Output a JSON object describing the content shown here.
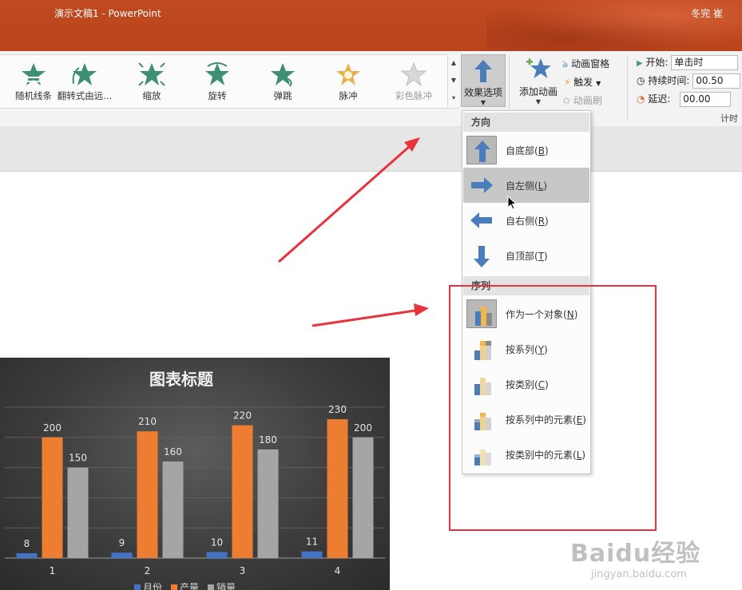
{
  "window": {
    "title": "演示文稿1  -  PowerPoint",
    "user": "冬完 崔"
  },
  "ribbon": {
    "gallery": [
      {
        "label": "随机线条",
        "icon": "random-bars-icon",
        "enabled": true
      },
      {
        "label": "翻转式由远...",
        "icon": "flip-icon",
        "enabled": true
      },
      {
        "label": "缩放",
        "icon": "zoom-icon",
        "enabled": true
      },
      {
        "label": "旋转",
        "icon": "spin-icon",
        "enabled": true
      },
      {
        "label": "弹跳",
        "icon": "bounce-icon",
        "enabled": true
      },
      {
        "label": "脉冲",
        "icon": "pulse-icon",
        "enabled": true
      },
      {
        "label": "彩色脉冲",
        "icon": "color-pulse-icon",
        "enabled": false
      }
    ],
    "effect_options": {
      "label": "效果选项"
    },
    "add_animation": {
      "label": "添加动画"
    },
    "animation_pane": {
      "label": "动画窗格"
    },
    "trigger": {
      "label": "触发"
    },
    "animation_painter": {
      "label": "动画刷"
    },
    "timing": {
      "start_label": "开始:",
      "start_value": "单击时",
      "duration_label": "持续时间:",
      "duration_value": "00.50",
      "delay_label": "延迟:",
      "delay_value": "00.00",
      "group_label": "计时"
    },
    "colors": {
      "accent_blue": "#4a7ebb",
      "star_green": "#3f8f74",
      "title_orange": "#bd4a1f"
    }
  },
  "menu": {
    "direction_header": "方向",
    "direction_items": [
      {
        "text": "自底部",
        "key": "B",
        "icon": "arrow-up-icon",
        "selected": true,
        "hover": false
      },
      {
        "text": "自左侧",
        "key": "L",
        "icon": "arrow-right-icon",
        "selected": false,
        "hover": true
      },
      {
        "text": "自右侧",
        "key": "R",
        "icon": "arrow-left-icon",
        "selected": false,
        "hover": false
      },
      {
        "text": "自顶部",
        "key": "T",
        "icon": "arrow-down-icon",
        "selected": false,
        "hover": false
      }
    ],
    "sequence_header": "序列",
    "sequence_items": [
      {
        "text": "作为一个对象",
        "key": "N",
        "icon": "as-one-object-icon",
        "selected": true
      },
      {
        "text": "按系列",
        "key": "Y",
        "icon": "by-series-icon",
        "selected": false
      },
      {
        "text": "按类别",
        "key": "C",
        "icon": "by-category-icon",
        "selected": false
      },
      {
        "text": "按系列中的元素",
        "key": "E",
        "icon": "by-element-in-series-icon",
        "selected": false
      },
      {
        "text": "按类别中的元素",
        "key": "L",
        "icon": "by-element-in-category-icon",
        "selected": false
      }
    ]
  },
  "chart_data": {
    "type": "bar",
    "title": "图表标题",
    "categories": [
      "1",
      "2",
      "3",
      "4"
    ],
    "series": [
      {
        "name": "月份",
        "values": [
          8,
          9,
          10,
          11
        ],
        "color": "#4472c4"
      },
      {
        "name": "产量",
        "values": [
          200,
          210,
          220,
          230
        ],
        "color": "#ed7d31"
      },
      {
        "name": "销量",
        "values": [
          150,
          160,
          180,
          200
        ],
        "color": "#a5a5a5"
      }
    ],
    "ylim": [
      0,
      250
    ],
    "grid": true,
    "legend": "bottom"
  },
  "watermark": {
    "line1": "Baidu经验",
    "line2": "jingyan.baidu.com"
  }
}
